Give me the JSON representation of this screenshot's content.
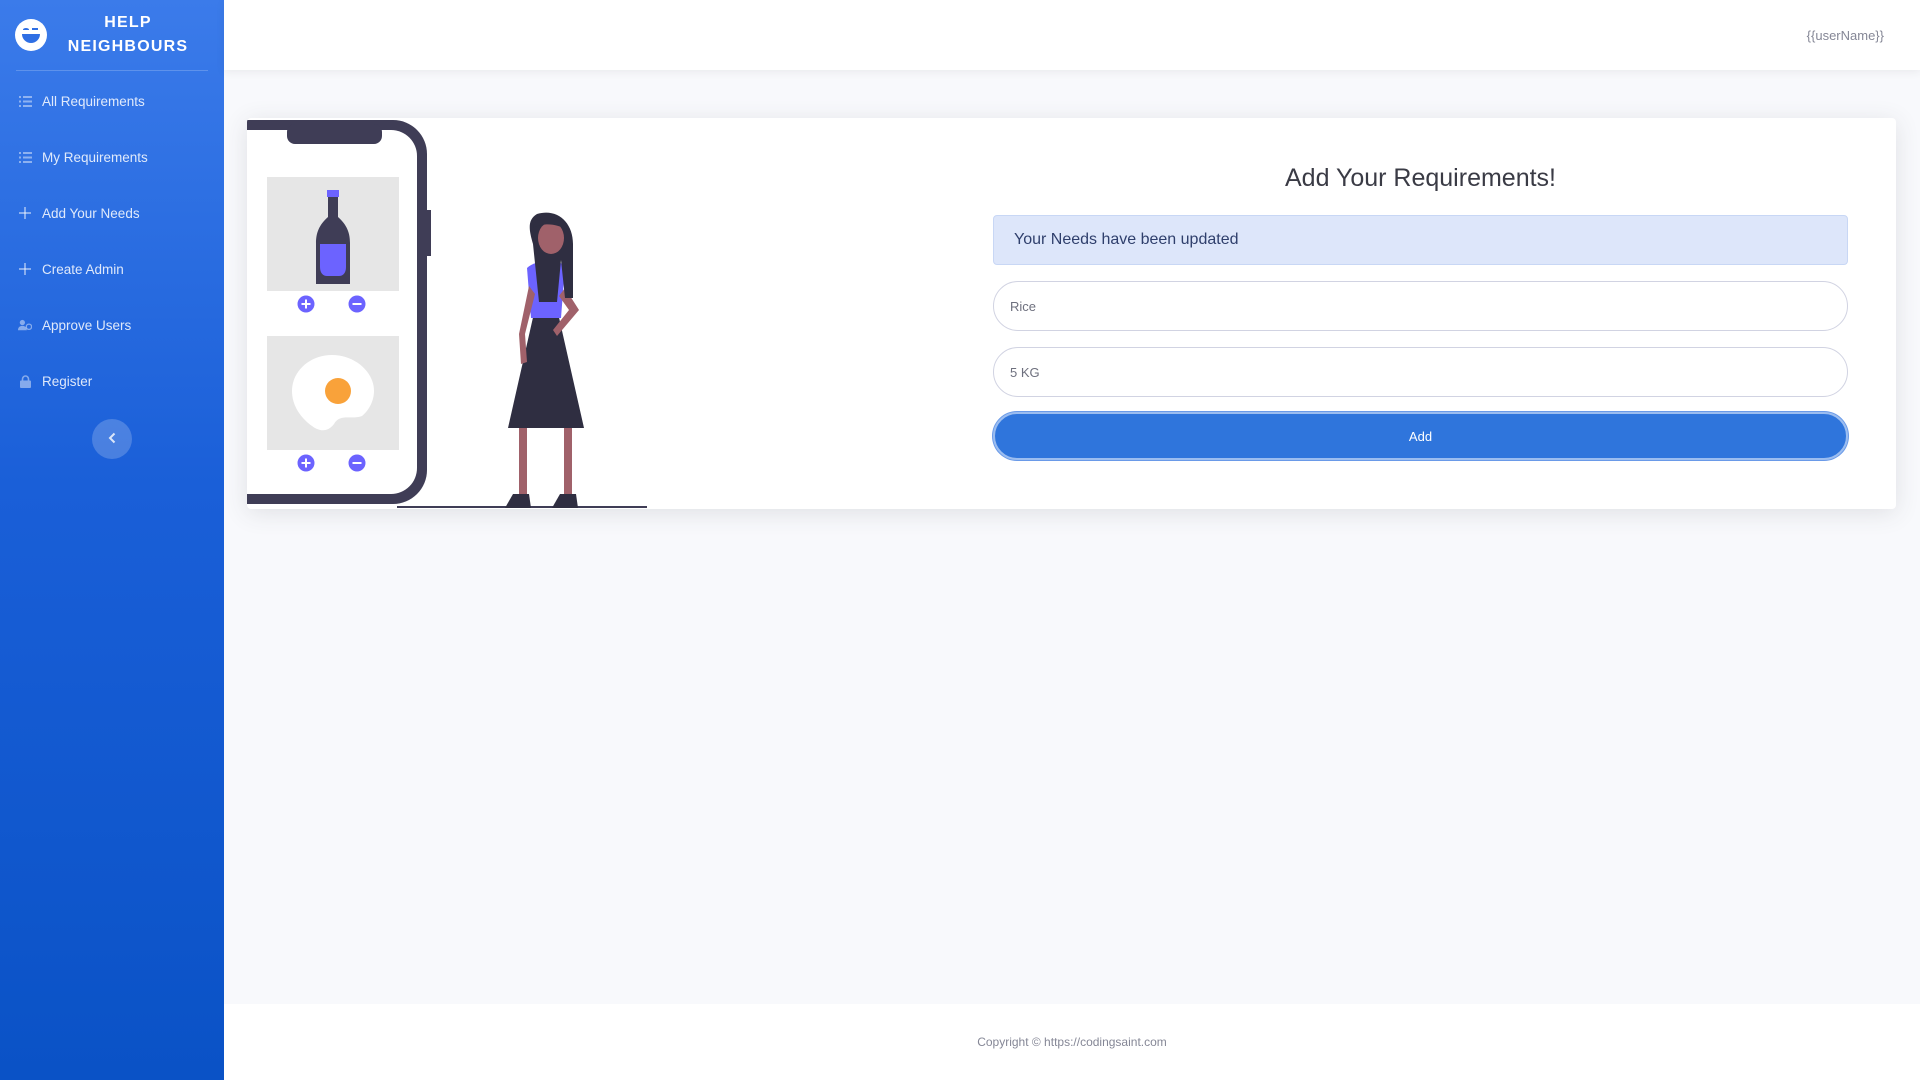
{
  "brand": {
    "line1": "HELP",
    "line2": "NEIGHBOURS",
    "icon": "laughing-face-icon"
  },
  "sidebar": {
    "items": [
      {
        "label": "All Requirements",
        "icon": "list-icon"
      },
      {
        "label": "My Requirements",
        "icon": "list-icon"
      },
      {
        "label": "Add Your Needs",
        "icon": "plus-icon"
      },
      {
        "label": "Create Admin",
        "icon": "plus-icon"
      },
      {
        "label": "Approve Users",
        "icon": "user-check-icon"
      },
      {
        "label": "Register",
        "icon": "lock-icon"
      }
    ],
    "toggle_icon": "chevron-left-icon"
  },
  "topbar": {
    "user_name": "{{userName}}"
  },
  "form": {
    "title": "Add Your Requirements!",
    "alert": "Your Needs have been updated",
    "item_value": "Rice",
    "quantity_value": "5 KG",
    "submit_label": "Add"
  },
  "footer": {
    "text": "Copyright © https://codingsaint.com"
  },
  "colors": {
    "sidebar_top": "#3b7bea",
    "sidebar_bottom": "#0a52c6",
    "primary_button": "#2f75dc",
    "alert_bg": "#dde6fa",
    "illustration_accent": "#6c63ff",
    "illustration_dark": "#3f3d56"
  }
}
